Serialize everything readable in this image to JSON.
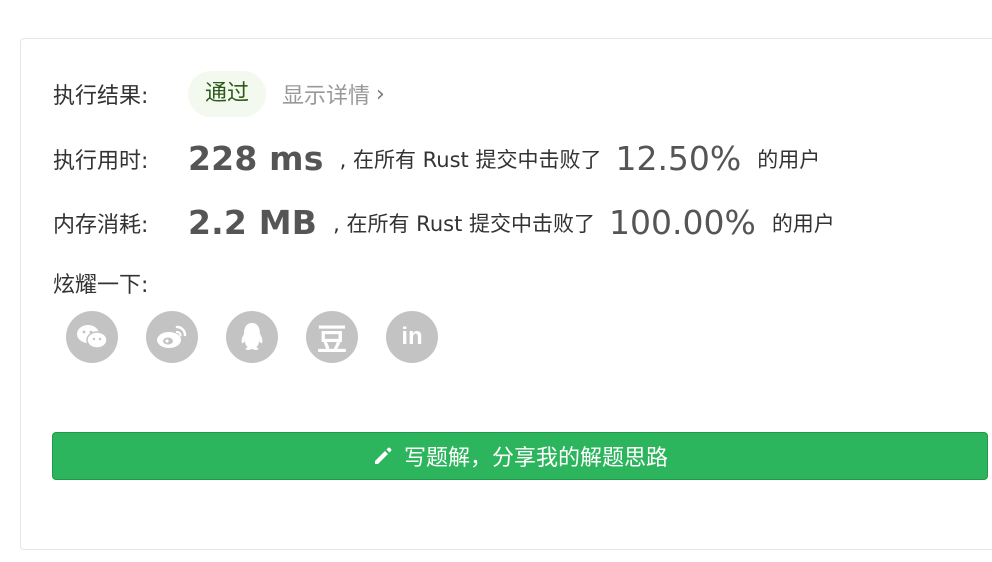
{
  "result": {
    "label": "执行结果:",
    "status": "通过",
    "details_link": "显示详情",
    "chevron": "›"
  },
  "runtime": {
    "label": "执行用时:",
    "value": "228 ms",
    "middle_text": ", 在所有 Rust 提交中击败了",
    "percent": "12.50%",
    "tail_text": "的用户"
  },
  "memory": {
    "label": "内存消耗:",
    "value": "2.2 MB",
    "middle_text": ", 在所有 Rust 提交中击败了",
    "percent": "100.00%",
    "tail_text": "的用户"
  },
  "share": {
    "label": "炫耀一下:",
    "icons": [
      "wechat-icon",
      "weibo-icon",
      "qq-icon",
      "douban-icon",
      "linkedin-icon"
    ],
    "douban_glyph": "豆",
    "linkedin_glyph": "in"
  },
  "write_button": {
    "label": "写题解，分享我的解题思路",
    "icon": "pencil-icon"
  },
  "colors": {
    "accent_green": "#2db55d",
    "pill_bg": "#f3f9ee",
    "icon_gray": "#c3c3c3"
  }
}
